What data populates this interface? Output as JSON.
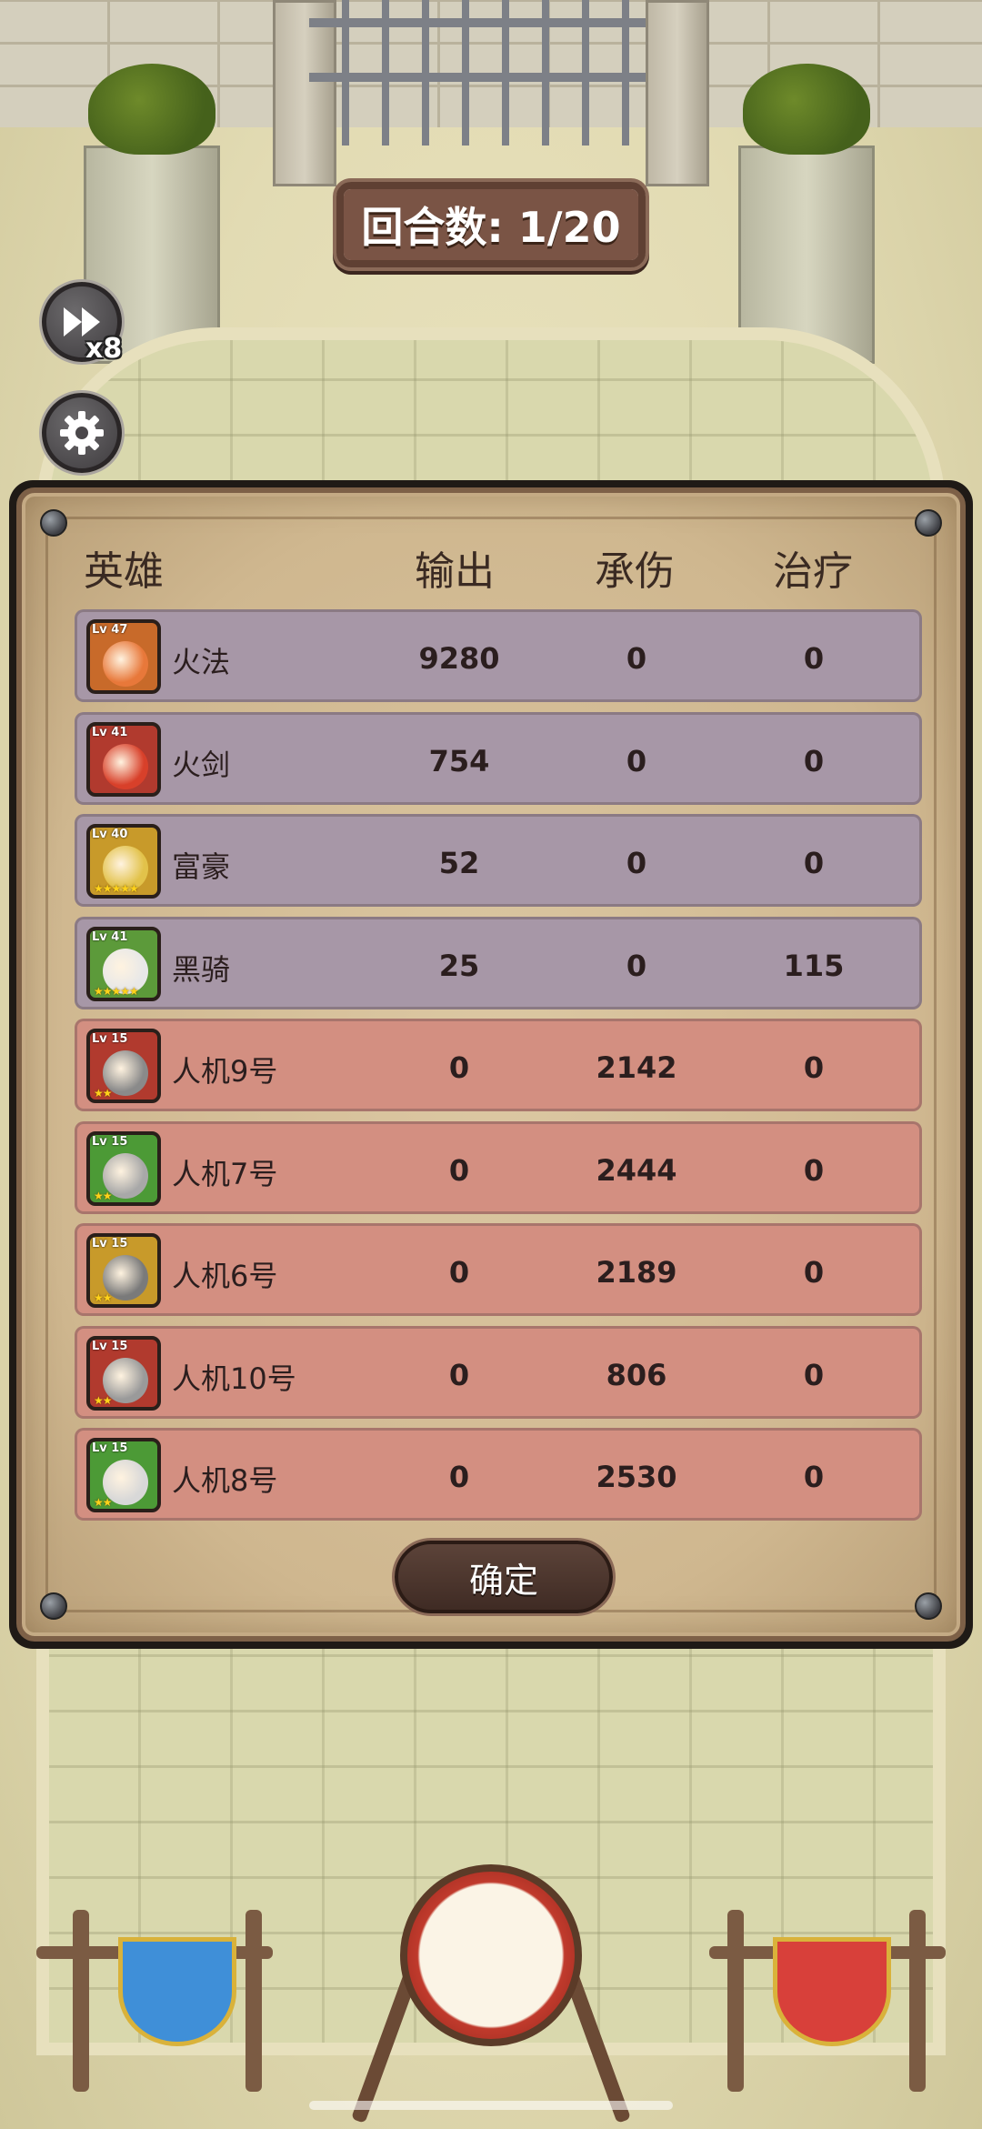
{
  "round": {
    "text": "回合数: 1/20"
  },
  "controls": {
    "speed_label": "x8",
    "speed_icon": "fast-forward-icon",
    "settings_icon": "gear-icon"
  },
  "stats": {
    "headers": {
      "hero": "英雄",
      "output": "输出",
      "damage_taken": "承伤",
      "healing": "治疗"
    },
    "rows": [
      {
        "name": "火法",
        "level": "Lv 47",
        "stars": "",
        "output": "9280",
        "taken": "0",
        "heal": "0",
        "side": "ally",
        "frame": "#c86a2a",
        "face": "#e8783a"
      },
      {
        "name": "火剑",
        "level": "Lv 41",
        "stars": "",
        "output": "754",
        "taken": "0",
        "heal": "0",
        "side": "ally",
        "frame": "#b13a2e",
        "face": "#d8402a"
      },
      {
        "name": "富豪",
        "level": "Lv 40",
        "stars": "★★★★★",
        "output": "52",
        "taken": "0",
        "heal": "0",
        "side": "ally",
        "frame": "#c89a2a",
        "face": "#e2c24a"
      },
      {
        "name": "黑骑",
        "level": "Lv 41",
        "stars": "★★★★★",
        "output": "25",
        "taken": "0",
        "heal": "115",
        "side": "ally",
        "frame": "#5c9a3a",
        "face": "#e8e8e8"
      },
      {
        "name": "人机9号",
        "level": "Lv 15",
        "stars": "★★",
        "output": "0",
        "taken": "2142",
        "heal": "0",
        "side": "enemy",
        "frame": "#b13a2e",
        "face": "#8a8a8a"
      },
      {
        "name": "人机7号",
        "level": "Lv 15",
        "stars": "★★",
        "output": "0",
        "taken": "2444",
        "heal": "0",
        "side": "enemy",
        "frame": "#4c9a36",
        "face": "#a8a8a8"
      },
      {
        "name": "人机6号",
        "level": "Lv 15",
        "stars": "★★",
        "output": "0",
        "taken": "2189",
        "heal": "0",
        "side": "enemy",
        "frame": "#c89a2a",
        "face": "#7a7a7a"
      },
      {
        "name": "人机10号",
        "level": "Lv 15",
        "stars": "★★",
        "output": "0",
        "taken": "806",
        "heal": "0",
        "side": "enemy",
        "frame": "#b13a2e",
        "face": "#9a9a9a"
      },
      {
        "name": "人机8号",
        "level": "Lv 15",
        "stars": "★★",
        "output": "0",
        "taken": "2530",
        "heal": "0",
        "side": "enemy",
        "frame": "#4c9a36",
        "face": "#d8d8d8"
      }
    ],
    "confirm_label": "确定"
  }
}
